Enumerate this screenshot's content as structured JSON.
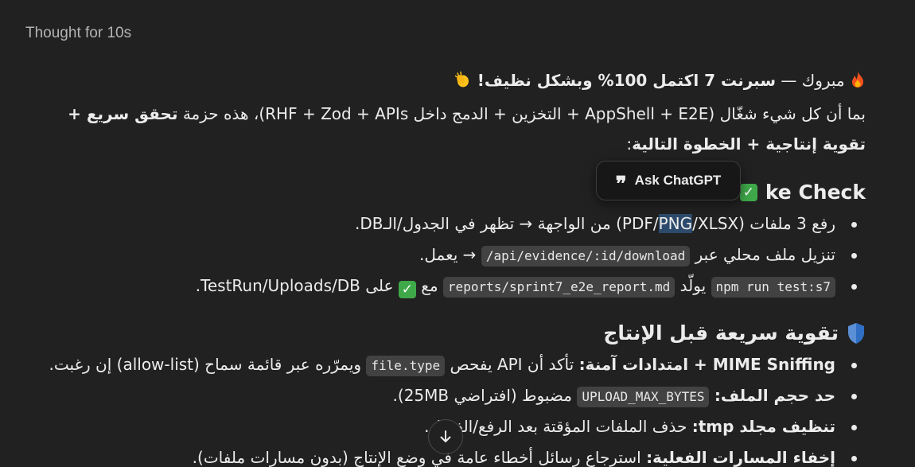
{
  "thought_label": "Thought for 10s",
  "intro": {
    "line1_pre": "مبروك — ",
    "line1_bold": "سبرنت 7 اكتمل 100%",
    "line1_post": " وبشكل نظيف!",
    "line2_pre": "بما أن كل شيء شغّال (AppShell + E2E + التخزين + الدمج داخل RHF + Zod + APIs)، هذه حزمة ",
    "line2_bold": "تحقق سريع + تقوية إنتاجية + الخطوة التالية",
    "line2_post": ":"
  },
  "section1": {
    "title_visible": "ke Check",
    "items": [
      {
        "pre": "رفع 3 ملفات (PDF/",
        "highlight": "PNG",
        "post": "/XLSX) من الواجهة → تظهر في الجدول/الـDB."
      },
      {
        "pre": "تنزيل ملف محلي عبر ",
        "code": "/api/evidence/:id/download",
        "post": " → يعمل."
      },
      {
        "code1": "npm run test:s7",
        "mid": " يولّد ",
        "code2": "reports/sprint7_e2e_report.md",
        "mid2": " مع ",
        "post": " على TestRun/Uploads/DB."
      }
    ]
  },
  "section2": {
    "title": "تقوية سريعة قبل الإنتاج",
    "items": [
      {
        "bold": "MIME Sniffing + امتدادات آمنة:",
        "pre": " تأكد أن API يفحص ",
        "code": "file.type",
        "post": " ويمرّره عبر قائمة سماح (allow-list) إن رغبت."
      },
      {
        "bold": "حد حجم الملف:",
        "pre": " ",
        "code": "UPLOAD_MAX_BYTES",
        "post": " مضبوط (افتراضي 25MB)."
      },
      {
        "bold": "تنظيف مجلد tmp:",
        "post": " حذف الملفات المؤقتة بعد الرفع/الفشل."
      },
      {
        "bold": "إخفاء المسارات الفعلية:",
        "post": " استرجاع رسائل أخطاء عامة في وضع الإنتاج (بدون مسارات ملفات)."
      }
    ]
  },
  "ask_popup": {
    "label": "Ask ChatGPT",
    "icon": "quote-icon"
  },
  "scroll_button": {
    "icon": "arrow-down-icon"
  },
  "colors": {
    "background": "#212121",
    "text": "#ececec",
    "code_bg": "#424242",
    "selection": "#2c4a6b",
    "check_green": "#3fa94a"
  }
}
